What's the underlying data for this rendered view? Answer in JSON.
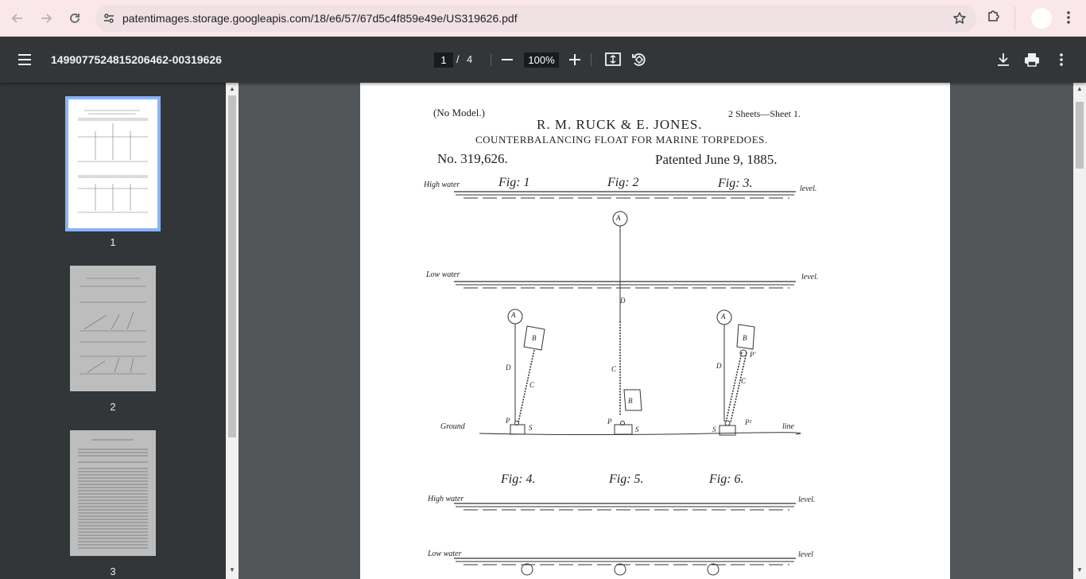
{
  "browser": {
    "url": "patentimages.storage.googleapis.com/18/e6/57/67d5c4f859e49e/US319626.pdf"
  },
  "toolbar": {
    "title": "14990775248152064​62-00319626",
    "current_page": "1",
    "separator": "/",
    "total_pages": "4",
    "zoom": "100%"
  },
  "sidebar": {
    "thumbnails": [
      {
        "label": "1"
      },
      {
        "label": "2"
      },
      {
        "label": "3"
      }
    ]
  },
  "patent": {
    "no_model": "(No Model.)",
    "sheets": "2 Sheets—Sheet 1.",
    "inventors": "R. M. RUCK & E. JONES.",
    "subject": "COUNTERBALANCING FLOAT FOR MARINE TORPEDOES.",
    "number": "No. 319,626.",
    "patented": "Patented June 9, 1885.",
    "fig1": "Fig: 1",
    "fig2": "Fig: 2",
    "fig3": "Fig: 3.",
    "fig4": "Fig: 4.",
    "fig5": "Fig: 5.",
    "fig6": "Fig: 6.",
    "high_water": "High water",
    "low_water": "Low water",
    "level": "level.",
    "level_plain": "level",
    "ground": "Ground",
    "line": "line",
    "label_A": "A",
    "label_B": "B",
    "label_C": "C",
    "label_D": "D",
    "label_P": "P",
    "label_S": "S",
    "label_P1": "P'",
    "label_P2": "P²"
  }
}
